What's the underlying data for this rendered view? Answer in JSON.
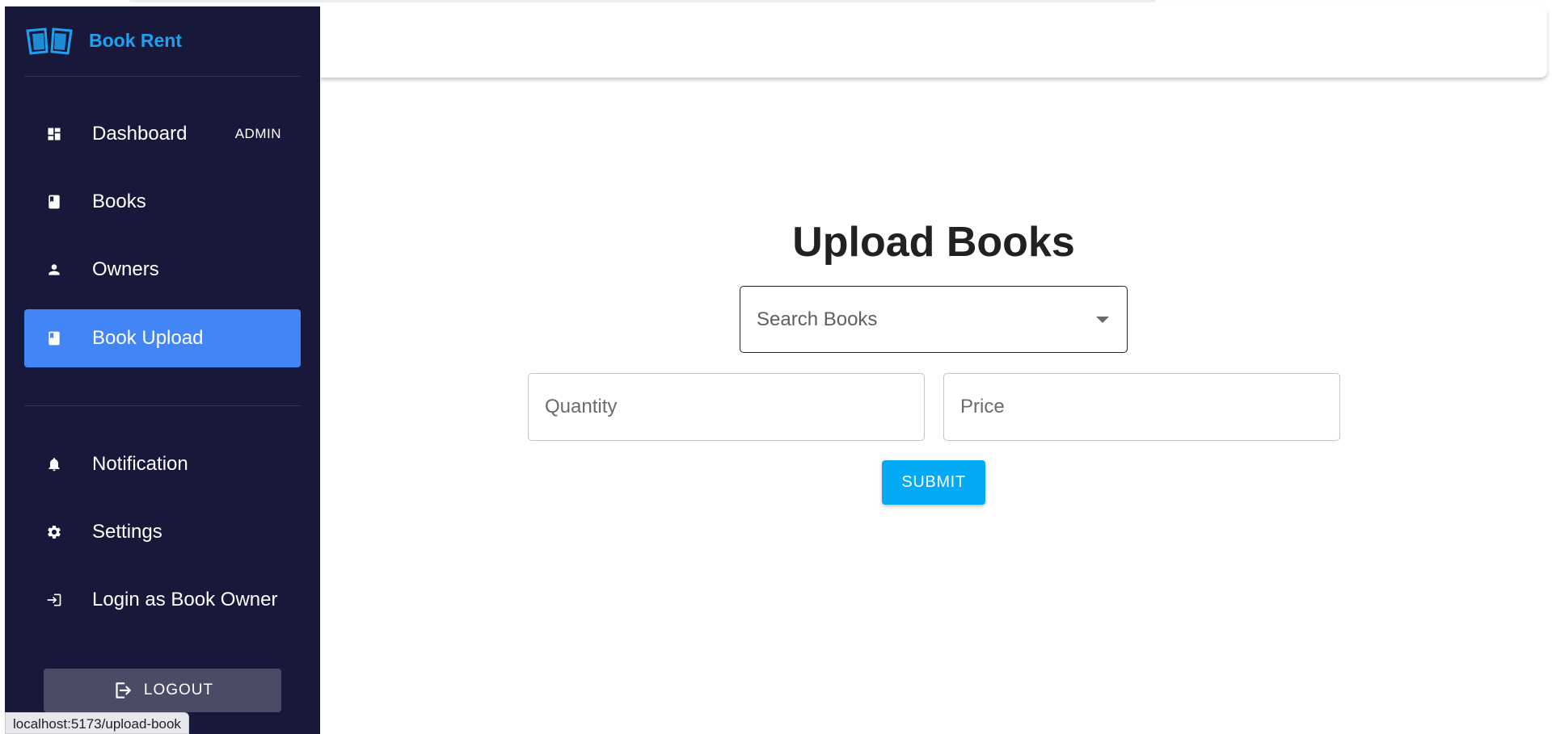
{
  "app": {
    "brand_name": "Book Rent",
    "brand_color": "#1ea1ef"
  },
  "sidebar": {
    "background": "#18193a",
    "active_color": "#4285f4",
    "items": [
      {
        "label": "Dashboard",
        "icon": "dashboard-icon",
        "badge": "ADMIN",
        "active": false
      },
      {
        "label": "Books",
        "icon": "book-icon",
        "active": false
      },
      {
        "label": "Owners",
        "icon": "person-icon",
        "active": false
      },
      {
        "label": "Book Upload",
        "icon": "book-icon",
        "active": true
      }
    ],
    "secondary_items": [
      {
        "label": "Notification",
        "icon": "bell-icon"
      },
      {
        "label": "Settings",
        "icon": "gear-icon"
      },
      {
        "label": "Login as Book Owner",
        "icon": "login-icon"
      }
    ],
    "logout_label": "LOGOUT"
  },
  "main": {
    "title": "Upload Books",
    "search_placeholder": "Search Books",
    "quantity_placeholder": "Quantity",
    "price_placeholder": "Price",
    "submit_label": "SUBMIT",
    "submit_color": "#03a9f4"
  },
  "status_bar": {
    "url": "localhost:5173/upload-book"
  }
}
